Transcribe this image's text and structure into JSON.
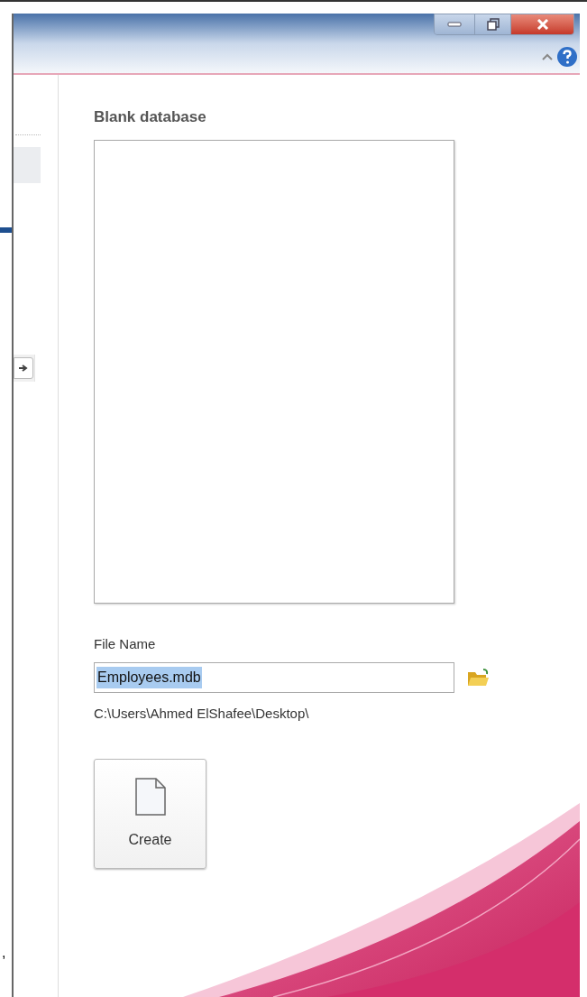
{
  "panel": {
    "heading": "Blank database"
  },
  "file_name": {
    "label": "File Name",
    "value": "Employees.mdb",
    "text_selected": true,
    "path": "C:\\Users\\Ahmed ElShafee\\Desktop\\"
  },
  "create_button": {
    "label": "Create"
  },
  "edge_mark": ","
}
